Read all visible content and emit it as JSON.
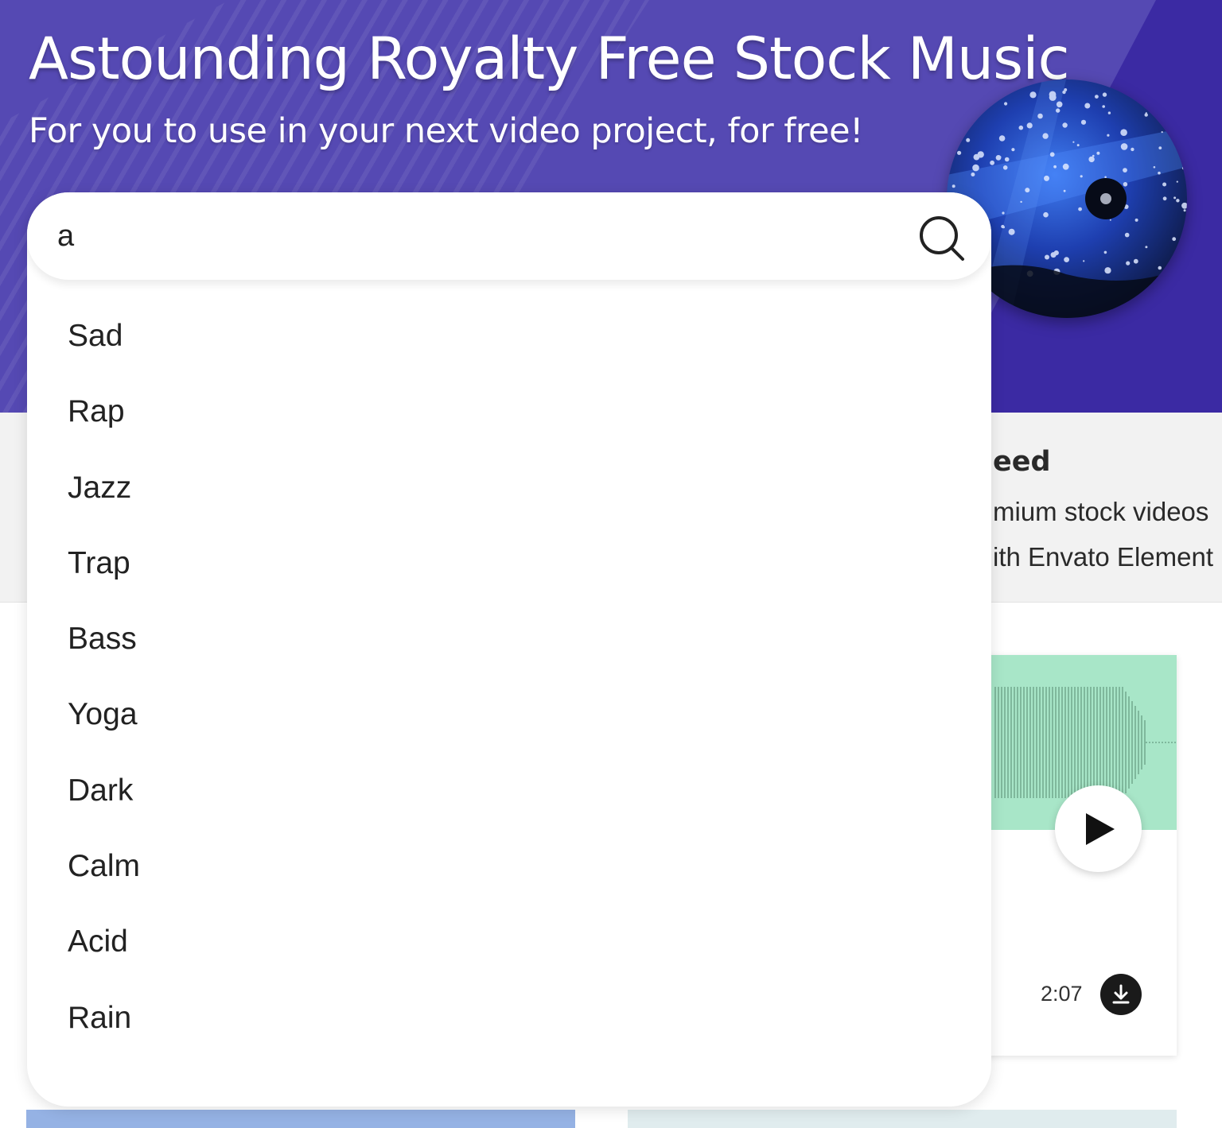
{
  "hero": {
    "title": "Astounding Royalty Free Stock Music",
    "subtitle": "For you to use in your next video project, for free!"
  },
  "search": {
    "value": "a",
    "suggestions": [
      {
        "label": "Sad"
      },
      {
        "label": "Rap"
      },
      {
        "label": "Jazz"
      },
      {
        "label": "Trap"
      },
      {
        "label": "Bass"
      },
      {
        "label": "Yoga"
      },
      {
        "label": "Dark"
      },
      {
        "label": "Calm"
      },
      {
        "label": "Acid"
      },
      {
        "label": "Rain"
      }
    ]
  },
  "promo": {
    "title": "eed",
    "line1": "mium stock videos",
    "line2": "ith Envato Element"
  },
  "track": {
    "duration": "2:07"
  },
  "icons": {
    "search": "search-icon",
    "play": "play-icon",
    "download": "download-icon"
  },
  "colors": {
    "hero_bg": "#5549b3",
    "hero_dark": "#3b2aa3",
    "wave_bg": "#a8e6c8",
    "promo_bg": "#f2f2f2"
  }
}
